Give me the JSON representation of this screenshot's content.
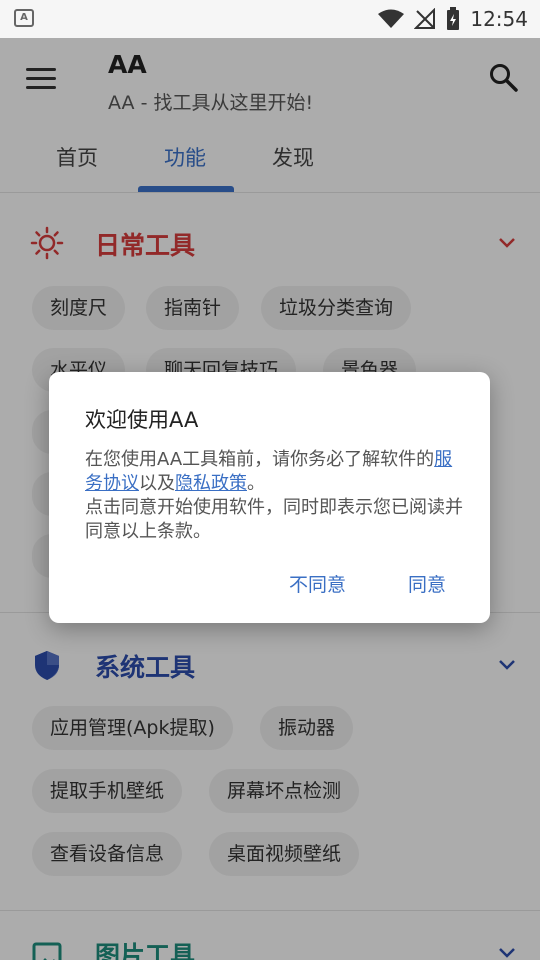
{
  "status_bar": {
    "time": "12:54",
    "left_icon": "a-icon"
  },
  "app_bar": {
    "title": "AA",
    "subtitle": "AA - 找工具从这里开始!",
    "menu_icon": "menu-icon",
    "search_icon": "search-icon"
  },
  "tabs": [
    {
      "label": "首页",
      "active": false
    },
    {
      "label": "功能",
      "active": true
    },
    {
      "label": "发现",
      "active": false
    }
  ],
  "sections": {
    "daily": {
      "title": "日常工具",
      "icon": "sun-icon",
      "color": "#d23b3b",
      "chips": [
        "刻度尺",
        "指南针",
        "垃圾分类查询",
        "水平仪",
        "聊天回复技巧",
        "景色器"
      ]
    },
    "system": {
      "title": "系统工具",
      "icon": "shield-icon",
      "color": "#2b4ba8",
      "chips": [
        "应用管理(Apk提取)",
        "振动器",
        "提取手机壁纸",
        "屏幕坏点检测",
        "查看设备信息",
        "桌面视频壁纸"
      ]
    },
    "image": {
      "title": "图片工具",
      "icon": "image-icon",
      "color": "#1e8a7a"
    }
  },
  "dialog": {
    "title": "欢迎使用AA",
    "body_prefix": "在您使用AA工具箱前，请你务必了解软件的",
    "link_service": "服务协议",
    "body_and": "以及",
    "link_privacy": "隐私政策",
    "body_end": "。",
    "body_line2": "点击同意开始使用软件，同时即表示您已阅读并同意以上条款。",
    "disagree_label": "不同意",
    "agree_label": "同意"
  },
  "colors": {
    "accent": "#3a6fc4"
  }
}
